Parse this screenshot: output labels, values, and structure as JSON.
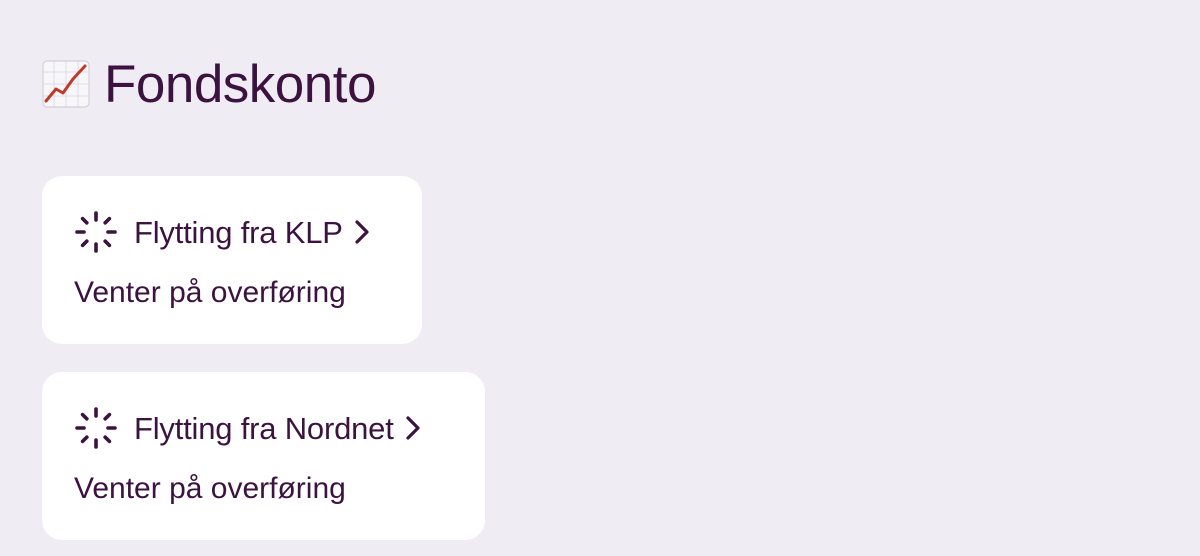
{
  "page": {
    "title": "Fondskonto",
    "title_icon": "chart-increasing-icon"
  },
  "transfers": [
    {
      "title": "Flytting fra KLP",
      "status": "Venter på overføring",
      "status_icon": "loading-spinner-icon",
      "action_icon": "chevron-right-icon"
    },
    {
      "title": "Flytting fra Nordnet",
      "status": "Venter på overføring",
      "status_icon": "loading-spinner-icon",
      "action_icon": "chevron-right-icon"
    }
  ],
  "colors": {
    "background": "#f0ecf4",
    "card": "#ffffff",
    "text": "#3b1240",
    "chart_line": "#c0392b"
  }
}
